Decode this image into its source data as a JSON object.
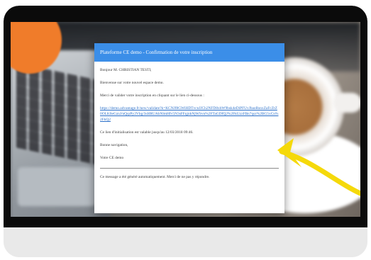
{
  "email": {
    "header": "Plateforme CE demo - Confirmation de votre inscription",
    "greeting": "Bonjour M. CHRISTIAN TESTI,",
    "welcome": "Bienvenue sur votre nouvel espace demo.",
    "instruction": "Merci de valider votre inscription en cliquant sur le lien ci-dessous :",
    "link": "https://demo.advantage.fr/new/validate?k=KCNJf8GWiHDTvcnJJCh2NFD8xbW9bsk4eDiPFUvJbaoRsnxZaFcZtZ0OLK0eGznJ/nQqrPy2Vbg/3sHRUAhNlmHfv5N3sFFqjnhNjWSvn%2FTaGDfQ2%2FkUzzFBn7qsz%2BG5vCn%2FkQ2",
    "validity": "Ce lien d'initialisation est valable jusqu'au 12/03/2018 09:46.",
    "signoff": "Bonne navigation,",
    "signature": "Votre CE demo",
    "footer": "Ce message a été généré automatiquement. Merci de ne pas y répondre."
  },
  "colors": {
    "header_blue": "#3b8ee8",
    "arrow_yellow": "#f5d90a",
    "accent_orange": "#f07c2a",
    "bezel": "#0b0b0b"
  }
}
